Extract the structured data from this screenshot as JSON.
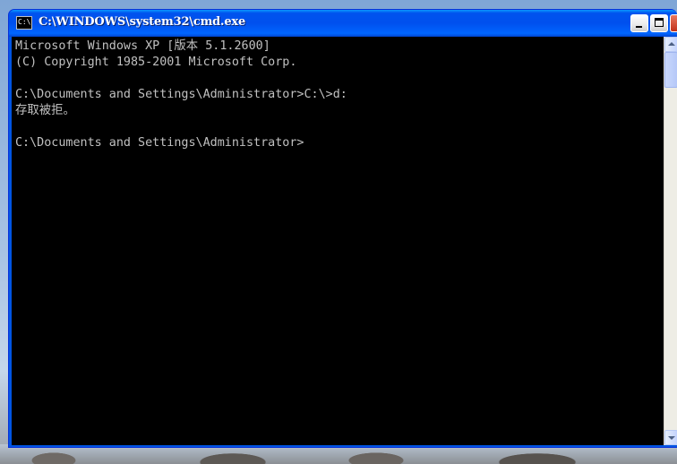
{
  "window": {
    "title": "C:\\WINDOWS\\system32\\cmd.exe",
    "icon_text": "C:\\"
  },
  "console": {
    "lines": [
      "Microsoft Windows XP [版本 5.1.2600]",
      "(C) Copyright 1985-2001 Microsoft Corp.",
      "",
      "C:\\Documents and Settings\\Administrator>C:\\>d:",
      "存取被拒。",
      "",
      "C:\\Documents and Settings\\Administrator>"
    ]
  },
  "colors": {
    "console_bg": "#000000",
    "console_fg": "#c0c0c0",
    "titlebar": "#0054e3"
  }
}
